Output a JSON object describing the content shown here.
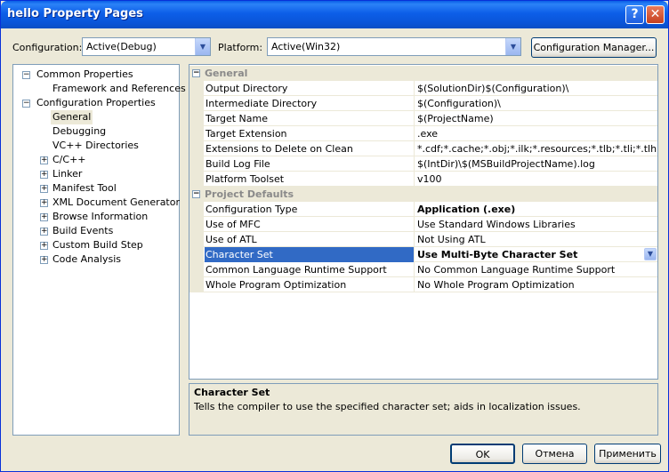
{
  "window": {
    "title": "hello Property Pages",
    "help_glyph": "?",
    "close_glyph": "✕"
  },
  "toolbar": {
    "configuration_label": "Configuration:",
    "configuration_value": "Active(Debug)",
    "platform_label": "Platform:",
    "platform_value": "Active(Win32)",
    "config_manager_label": "Configuration Manager..."
  },
  "tree": {
    "common_properties": "Common Properties",
    "framework_references": "Framework and References",
    "configuration_properties": "Configuration Properties",
    "items": [
      "General",
      "Debugging",
      "VC++ Directories",
      "C/C++",
      "Linker",
      "Manifest Tool",
      "XML Document Generator",
      "Browse Information",
      "Build Events",
      "Custom Build Step",
      "Code Analysis"
    ]
  },
  "grid": {
    "categories": {
      "general": "General",
      "project_defaults": "Project Defaults"
    },
    "general_rows": [
      {
        "name": "Output Directory",
        "value": "$(SolutionDir)$(Configuration)\\"
      },
      {
        "name": "Intermediate Directory",
        "value": "$(Configuration)\\"
      },
      {
        "name": "Target Name",
        "value": "$(ProjectName)"
      },
      {
        "name": "Target Extension",
        "value": ".exe"
      },
      {
        "name": "Extensions to Delete on Clean",
        "value": "*.cdf;*.cache;*.obj;*.ilk;*.resources;*.tlb;*.tli;*.tlh;*.tmp"
      },
      {
        "name": "Build Log File",
        "value": "$(IntDir)\\$(MSBuildProjectName).log"
      },
      {
        "name": "Platform Toolset",
        "value": "v100"
      }
    ],
    "defaults_rows": [
      {
        "name": "Configuration Type",
        "value": "Application (.exe)"
      },
      {
        "name": "Use of MFC",
        "value": "Use Standard Windows Libraries"
      },
      {
        "name": "Use of ATL",
        "value": "Not Using ATL"
      },
      {
        "name": "Character Set",
        "value": "Use Multi-Byte Character Set"
      },
      {
        "name": "Common Language Runtime Support",
        "value": "No Common Language Runtime Support"
      },
      {
        "name": "Whole Program Optimization",
        "value": "No Whole Program Optimization"
      }
    ]
  },
  "description": {
    "title": "Character Set",
    "text": "Tells the compiler to use the specified character set; aids in localization issues."
  },
  "buttons": {
    "ok": "OK",
    "cancel": "Отмена",
    "apply": "Применить"
  }
}
